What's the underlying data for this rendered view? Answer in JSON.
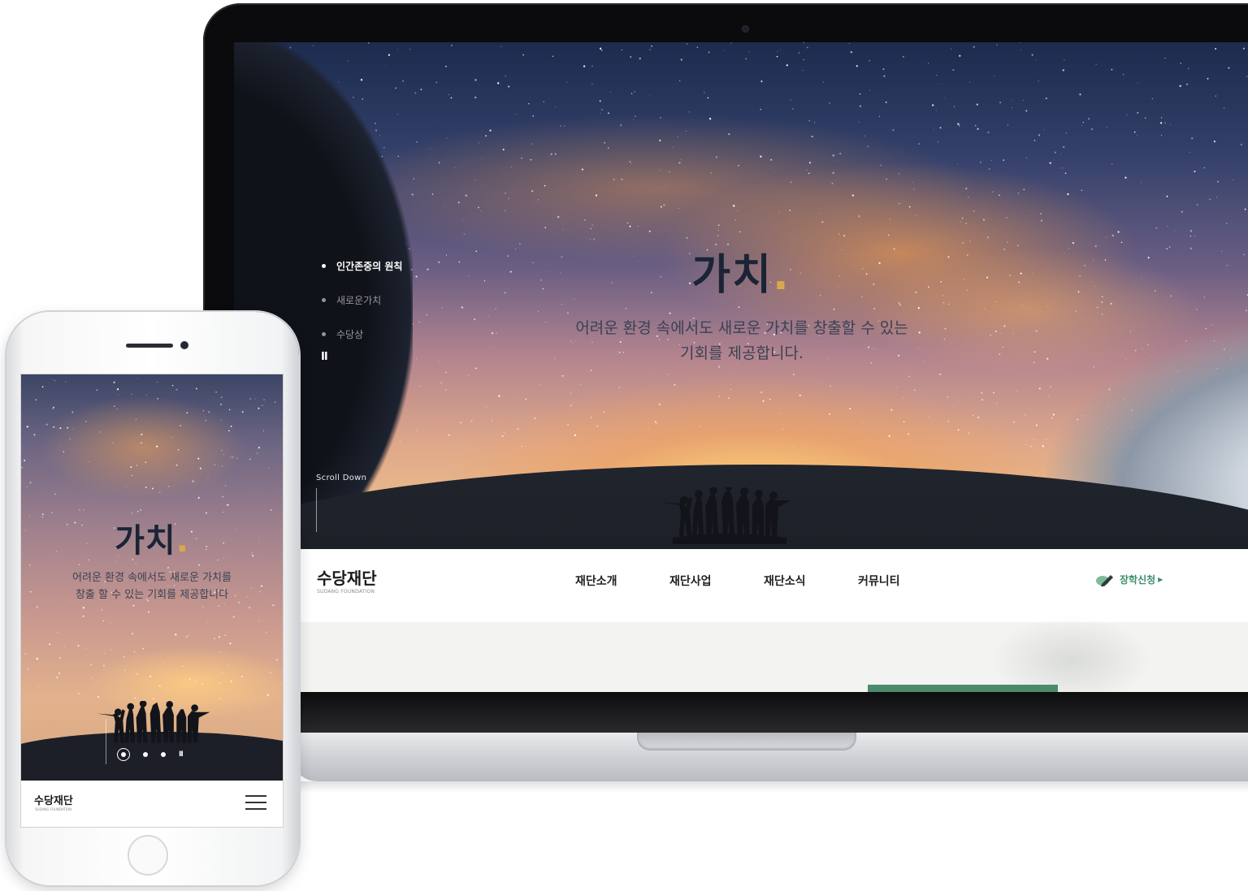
{
  "desktop": {
    "hero": {
      "title": "가치",
      "title_dot": ".",
      "subtitle_line1": "어려운 환경 속에서도 새로운 가치를 창출할 수 있는",
      "subtitle_line2": "기회를 제공합니다.",
      "slide_nav": [
        {
          "label": "인간존중의 원칙",
          "active": true
        },
        {
          "label": "새로운가치",
          "active": false
        },
        {
          "label": "수당상",
          "active": false
        }
      ],
      "pause_label": "II",
      "scroll_down_label": "Scroll Down"
    },
    "header": {
      "logo": "수당재단",
      "logo_sub": "SUDANG FOUNDATION",
      "menu": [
        "재단소개",
        "재단사업",
        "재단소식",
        "커뮤니티"
      ],
      "apply_label": "장학신청",
      "apply_icon": "pen-icon",
      "accent_color": "#3b8d6c"
    }
  },
  "mobile": {
    "hero": {
      "title": "가치",
      "title_dot": ".",
      "subtitle_line1": "어려운 환경 속에서도 새로운 가치를",
      "subtitle_line2": "창출 할 수 있는 기회를 제공합니다",
      "pause_label": "II",
      "active_slide": 1,
      "slide_count": 3
    },
    "header": {
      "logo": "수당재단",
      "logo_sub": "SUDANG FOUNDATION",
      "menu_icon": "hamburger-icon"
    }
  },
  "colors": {
    "title": "#1b2436",
    "title_dot": "#d8a948",
    "green_accent": "#4d8a6c"
  }
}
